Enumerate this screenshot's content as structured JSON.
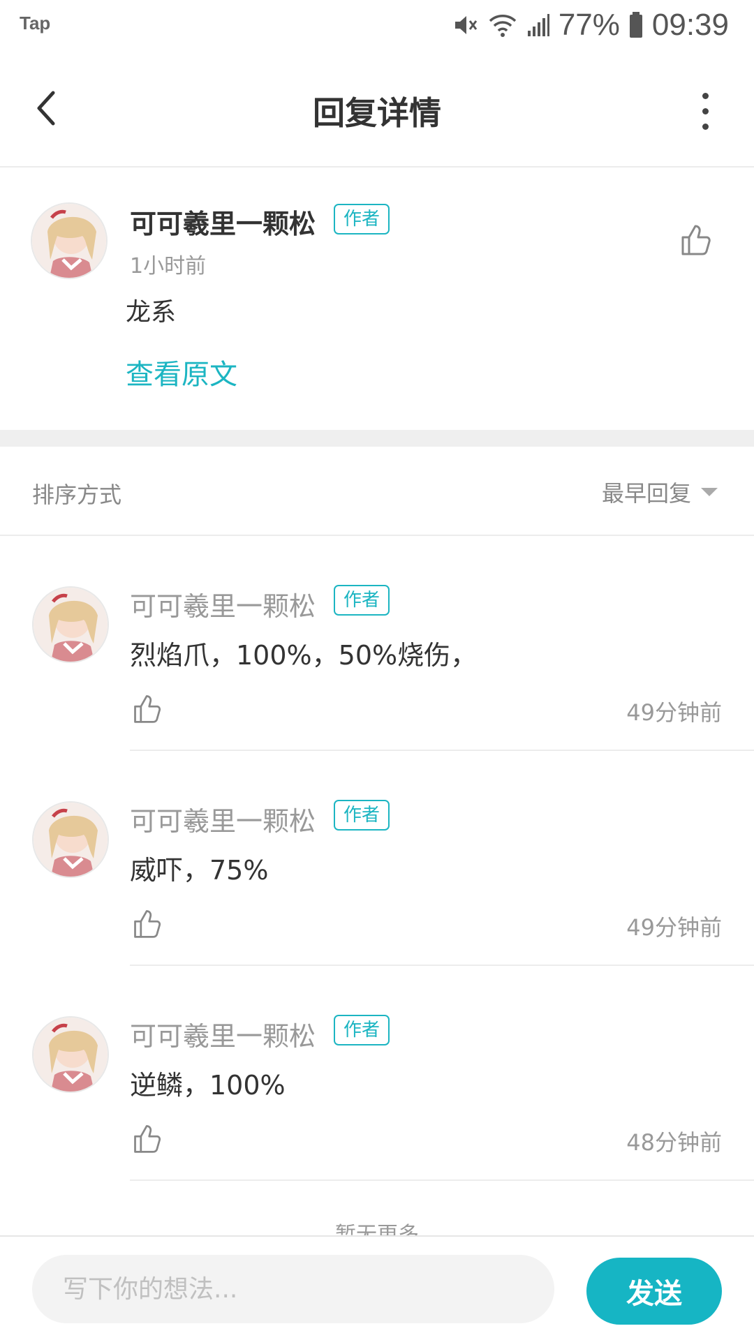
{
  "status_bar": {
    "app_label": "Tap",
    "battery": "77%",
    "time": "09:39",
    "icons": [
      "mute-icon",
      "wifi-icon",
      "signal-icon",
      "battery-icon"
    ]
  },
  "header": {
    "title": "回复详情",
    "back_icon": "chevron-left-icon",
    "more_icon": "more-vertical-icon"
  },
  "main_comment": {
    "author": "可可羲里一颗松",
    "badge": "作者",
    "time": "1小时前",
    "content": "龙系",
    "view_original": "查看原文"
  },
  "sort": {
    "label": "排序方式",
    "value": "最早回复"
  },
  "replies": [
    {
      "author": "可可羲里一颗松",
      "badge": "作者",
      "text": "烈焰爪，100%，50%烧伤，",
      "time": "49分钟前"
    },
    {
      "author": "可可羲里一颗松",
      "badge": "作者",
      "text": "威吓，75%",
      "time": "49分钟前"
    },
    {
      "author": "可可羲里一颗松",
      "badge": "作者",
      "text": "逆鳞，100%",
      "time": "48分钟前"
    }
  ],
  "footer_note": "暂无更多",
  "composer": {
    "placeholder": "写下你的想法...",
    "send_label": "发送"
  },
  "colors": {
    "accent": "#1cb5c2",
    "send_button": "#16b5c4"
  }
}
